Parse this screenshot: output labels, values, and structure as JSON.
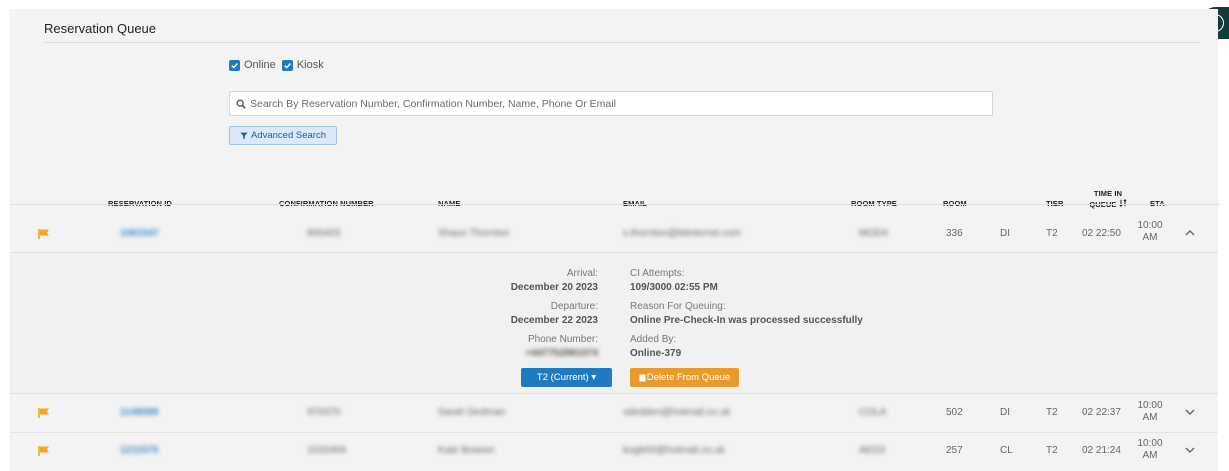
{
  "page": {
    "title": "Reservation Queue",
    "help_icon_label": "?"
  },
  "filters": [
    {
      "label": "Online",
      "checked": true
    },
    {
      "label": "Kiosk",
      "checked": true
    }
  ],
  "search": {
    "placeholder": "Search By Reservation Number, Confirmation Number, Name, Phone Or Email"
  },
  "advanced_search_label": "Advanced Search",
  "table": {
    "columns": {
      "reservation_id": "RESERVATION ID",
      "confirmation_number": "CONFIRMATION NUMBER",
      "name": "NAME",
      "email": "EMAIL",
      "room_type": "ROOM TYPE",
      "room": "ROOM",
      "tier": "TIER",
      "time_in_queue_1": "TIME IN",
      "time_in_queue_2": "QUEUE",
      "eta": "ETA"
    },
    "rows": [
      {
        "reservation_id": "1061547",
        "confirmation_number": "900403",
        "name": "Shaun Thornton",
        "email": "s.thornton@btinternet.com",
        "room_type": "MOD4",
        "room": "336",
        "room_code": "DI",
        "tier": "T2",
        "time_in_queue": "02 22:50",
        "eta_1": "10:00",
        "eta_2": "AM",
        "expanded": true
      },
      {
        "reservation_id": "1149088",
        "confirmation_number": "970370",
        "name": "Sarah Dedman",
        "email": "sdedden@hotmail.co.uk",
        "room_type": "COLA",
        "room": "502",
        "room_code": "DI",
        "tier": "T2",
        "time_in_queue": "02 22:37",
        "eta_1": "10:00",
        "eta_2": "AM",
        "expanded": false
      },
      {
        "reservation_id": "1211575",
        "confirmation_number": "1020469",
        "name": "Kate Bowser",
        "email": "kogb00@hotmail.co.uk",
        "room_type": "AED3",
        "room": "257",
        "room_code": "CL",
        "tier": "T2",
        "time_in_queue": "02 21:24",
        "eta_1": "10:00",
        "eta_2": "AM",
        "expanded": false
      }
    ]
  },
  "details": {
    "arrival_label": "Arrival:",
    "arrival_value": "December 20 2023",
    "departure_label": "Departure:",
    "departure_value": "December 22 2023",
    "phone_label": "Phone Number:",
    "phone_value": "+447752881074",
    "ci_attempts_label": "CI Attempts:",
    "ci_attempts_value": "109/3000 02:55 PM",
    "reason_label": "Reason For Queuing:",
    "reason_value": "Online Pre-Check-In was processed successfully",
    "added_by_label": "Added By:",
    "added_by_value": "Online-379",
    "tier_button": "T2 (Current) ▾",
    "delete_button": "Delete From Queue"
  },
  "colors": {
    "accent_blue": "#1f7bc1",
    "flag_orange": "#f5a623",
    "delete_orange": "#e99a2a",
    "help_bg": "#123c3c"
  }
}
